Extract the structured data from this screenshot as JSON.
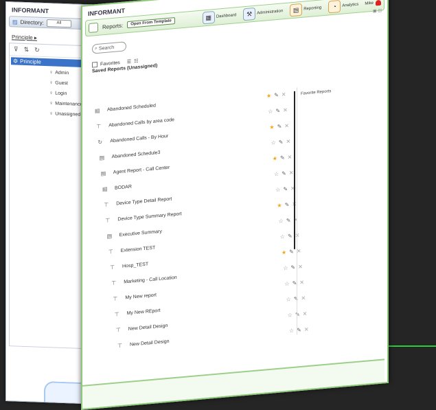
{
  "back_window": {
    "logo": "INFORMANT",
    "directory_label": "Directory:",
    "directory_value": "All",
    "path": "Principle",
    "tree": {
      "root": "Principle",
      "children": [
        "Admin",
        "Guest",
        "Login",
        "Maintenance",
        "Unassigned"
      ]
    }
  },
  "front_window": {
    "logo": "INFORMANT",
    "reports_label": "Reports:",
    "active_tab": "Open From Template",
    "nav": [
      {
        "label": "Dashboard",
        "icon": "dashboard-icon"
      },
      {
        "label": "Administration",
        "icon": "admin-icon"
      },
      {
        "label": "Reporting",
        "icon": "reporting-icon"
      },
      {
        "label": "Analytics",
        "icon": "analytics-icon"
      }
    ],
    "user": "Mike",
    "search_placeholder": "Search",
    "favorites_label": "Favorites",
    "saved_reports_title": "Saved Reports (Unassigned)",
    "side_panel_label": "Favorite Reports",
    "reports": [
      {
        "name": "Abandoned Scheduled",
        "icon": "document-icon",
        "favorite": true
      },
      {
        "name": "Abandoned Calls by area code",
        "icon": "table-icon",
        "favorite": false
      },
      {
        "name": "Abandoned Calls - By Hour",
        "icon": "refresh-icon",
        "favorite": true
      },
      {
        "name": "Abandoned Schedule3",
        "icon": "document-icon",
        "favorite": false
      },
      {
        "name": "Agent Report - Call Center",
        "icon": "document-icon",
        "favorite": true
      },
      {
        "name": "BODAR",
        "icon": "document-icon",
        "favorite": false
      },
      {
        "name": "Device Type Detail Report",
        "icon": "table-icon",
        "favorite": false
      },
      {
        "name": "Device Type Summary Report",
        "icon": "table-icon",
        "favorite": true
      },
      {
        "name": "Executive Summary",
        "icon": "document-icon",
        "favorite": false
      },
      {
        "name": "Extension TEST",
        "icon": "table-icon",
        "favorite": false
      },
      {
        "name": "Hosp_TEST",
        "icon": "table-icon",
        "favorite": true
      },
      {
        "name": "Marketing - Call Location",
        "icon": "table-icon",
        "favorite": false
      },
      {
        "name": "My New report",
        "icon": "table-icon",
        "favorite": false
      },
      {
        "name": "My New REport",
        "icon": "table-icon",
        "favorite": false
      },
      {
        "name": "New Detail Design",
        "icon": "table-icon",
        "favorite": false
      },
      {
        "name": "New Detail Design",
        "icon": "table-icon",
        "favorite": false
      }
    ]
  },
  "colors": {
    "background": "#252525",
    "accent_green": "#2ecc40",
    "window_border": "#8ec97a",
    "selected_blue": "#3b73c8",
    "star": "#f2a711"
  }
}
